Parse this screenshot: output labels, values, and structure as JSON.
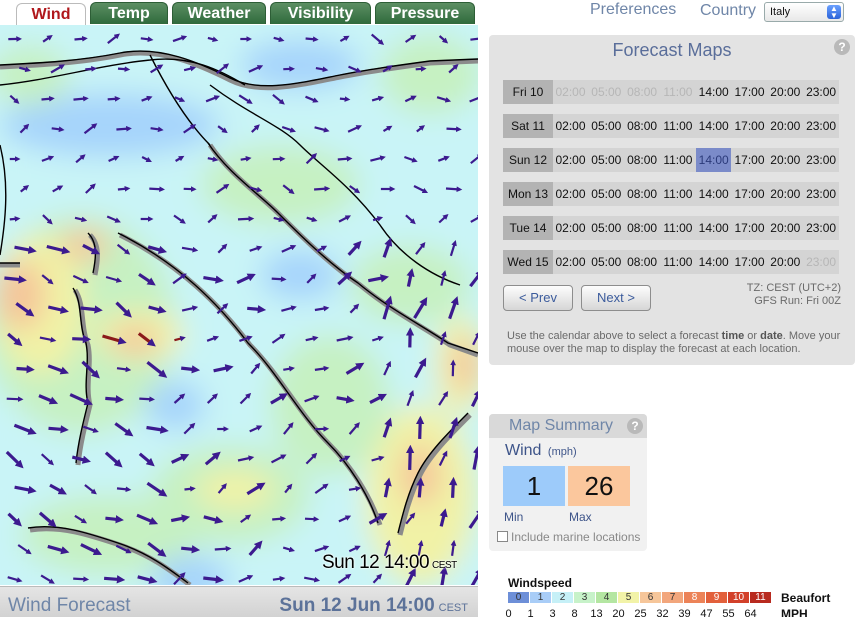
{
  "tabs": [
    {
      "label": "Wind",
      "active": true
    },
    {
      "label": "Temp",
      "active": false
    },
    {
      "label": "Weather",
      "active": false
    },
    {
      "label": "Visibility",
      "active": false
    },
    {
      "label": "Pressure",
      "active": false
    }
  ],
  "header": {
    "preferences": "Preferences",
    "country_label": "Country",
    "country_value": "Italy"
  },
  "map": {
    "timestamp": "Sun 12 14:00",
    "tz": "CEST"
  },
  "footer": {
    "title": "Wind Forecast",
    "date": "Sun 12 Jun 14:00",
    "tz": "CEST"
  },
  "forecast": {
    "title": "Forecast Maps",
    "help": "?",
    "times": [
      "02:00",
      "05:00",
      "08:00",
      "11:00",
      "14:00",
      "17:00",
      "20:00",
      "23:00"
    ],
    "days": [
      {
        "name": "Fri 10",
        "unavailable": [
          0,
          1,
          2,
          3
        ]
      },
      {
        "name": "Sat 11",
        "unavailable": []
      },
      {
        "name": "Sun 12",
        "unavailable": [],
        "selected": 4
      },
      {
        "name": "Mon 13",
        "unavailable": []
      },
      {
        "name": "Tue 14",
        "unavailable": []
      },
      {
        "name": "Wed 15",
        "unavailable": [
          7
        ]
      }
    ],
    "prev_label": "< Prev",
    "next_label": "Next >",
    "tz_info": "TZ: CEST (UTC+2)",
    "gfs_run": "GFS Run: Fri 00Z",
    "instructions_1": "Use the calendar above to select a forecast ",
    "instructions_time": "time",
    "instructions_2": " or ",
    "instructions_date": "date",
    "instructions_3": ". Move your mouse over the map to display the forecast at each location."
  },
  "summary": {
    "title": "Map Summary",
    "help": "?",
    "variable": "Wind",
    "unit": "(mph)",
    "min": "1",
    "max": "26",
    "min_label": "Min",
    "max_label": "Max",
    "marine_label": "Include marine locations"
  },
  "legend": {
    "title": "Windspeed",
    "beaufort_label": "Beaufort",
    "mph_label": "MPH",
    "beaufort": [
      "0",
      "1",
      "2",
      "3",
      "4",
      "5",
      "6",
      "7",
      "8",
      "9",
      "10",
      "11"
    ],
    "mph": [
      "0",
      "1",
      "3",
      "8",
      "13",
      "20",
      "25",
      "32",
      "39",
      "47",
      "55",
      "64"
    ],
    "colors": [
      "#6d8fd8",
      "#a9cdf7",
      "#c6f0f7",
      "#c7f2c9",
      "#b4e6a2",
      "#f2f3a8",
      "#f6c69a",
      "#f2a67c",
      "#ec8358",
      "#e2603b",
      "#d2402a",
      "#b82a1f"
    ]
  }
}
